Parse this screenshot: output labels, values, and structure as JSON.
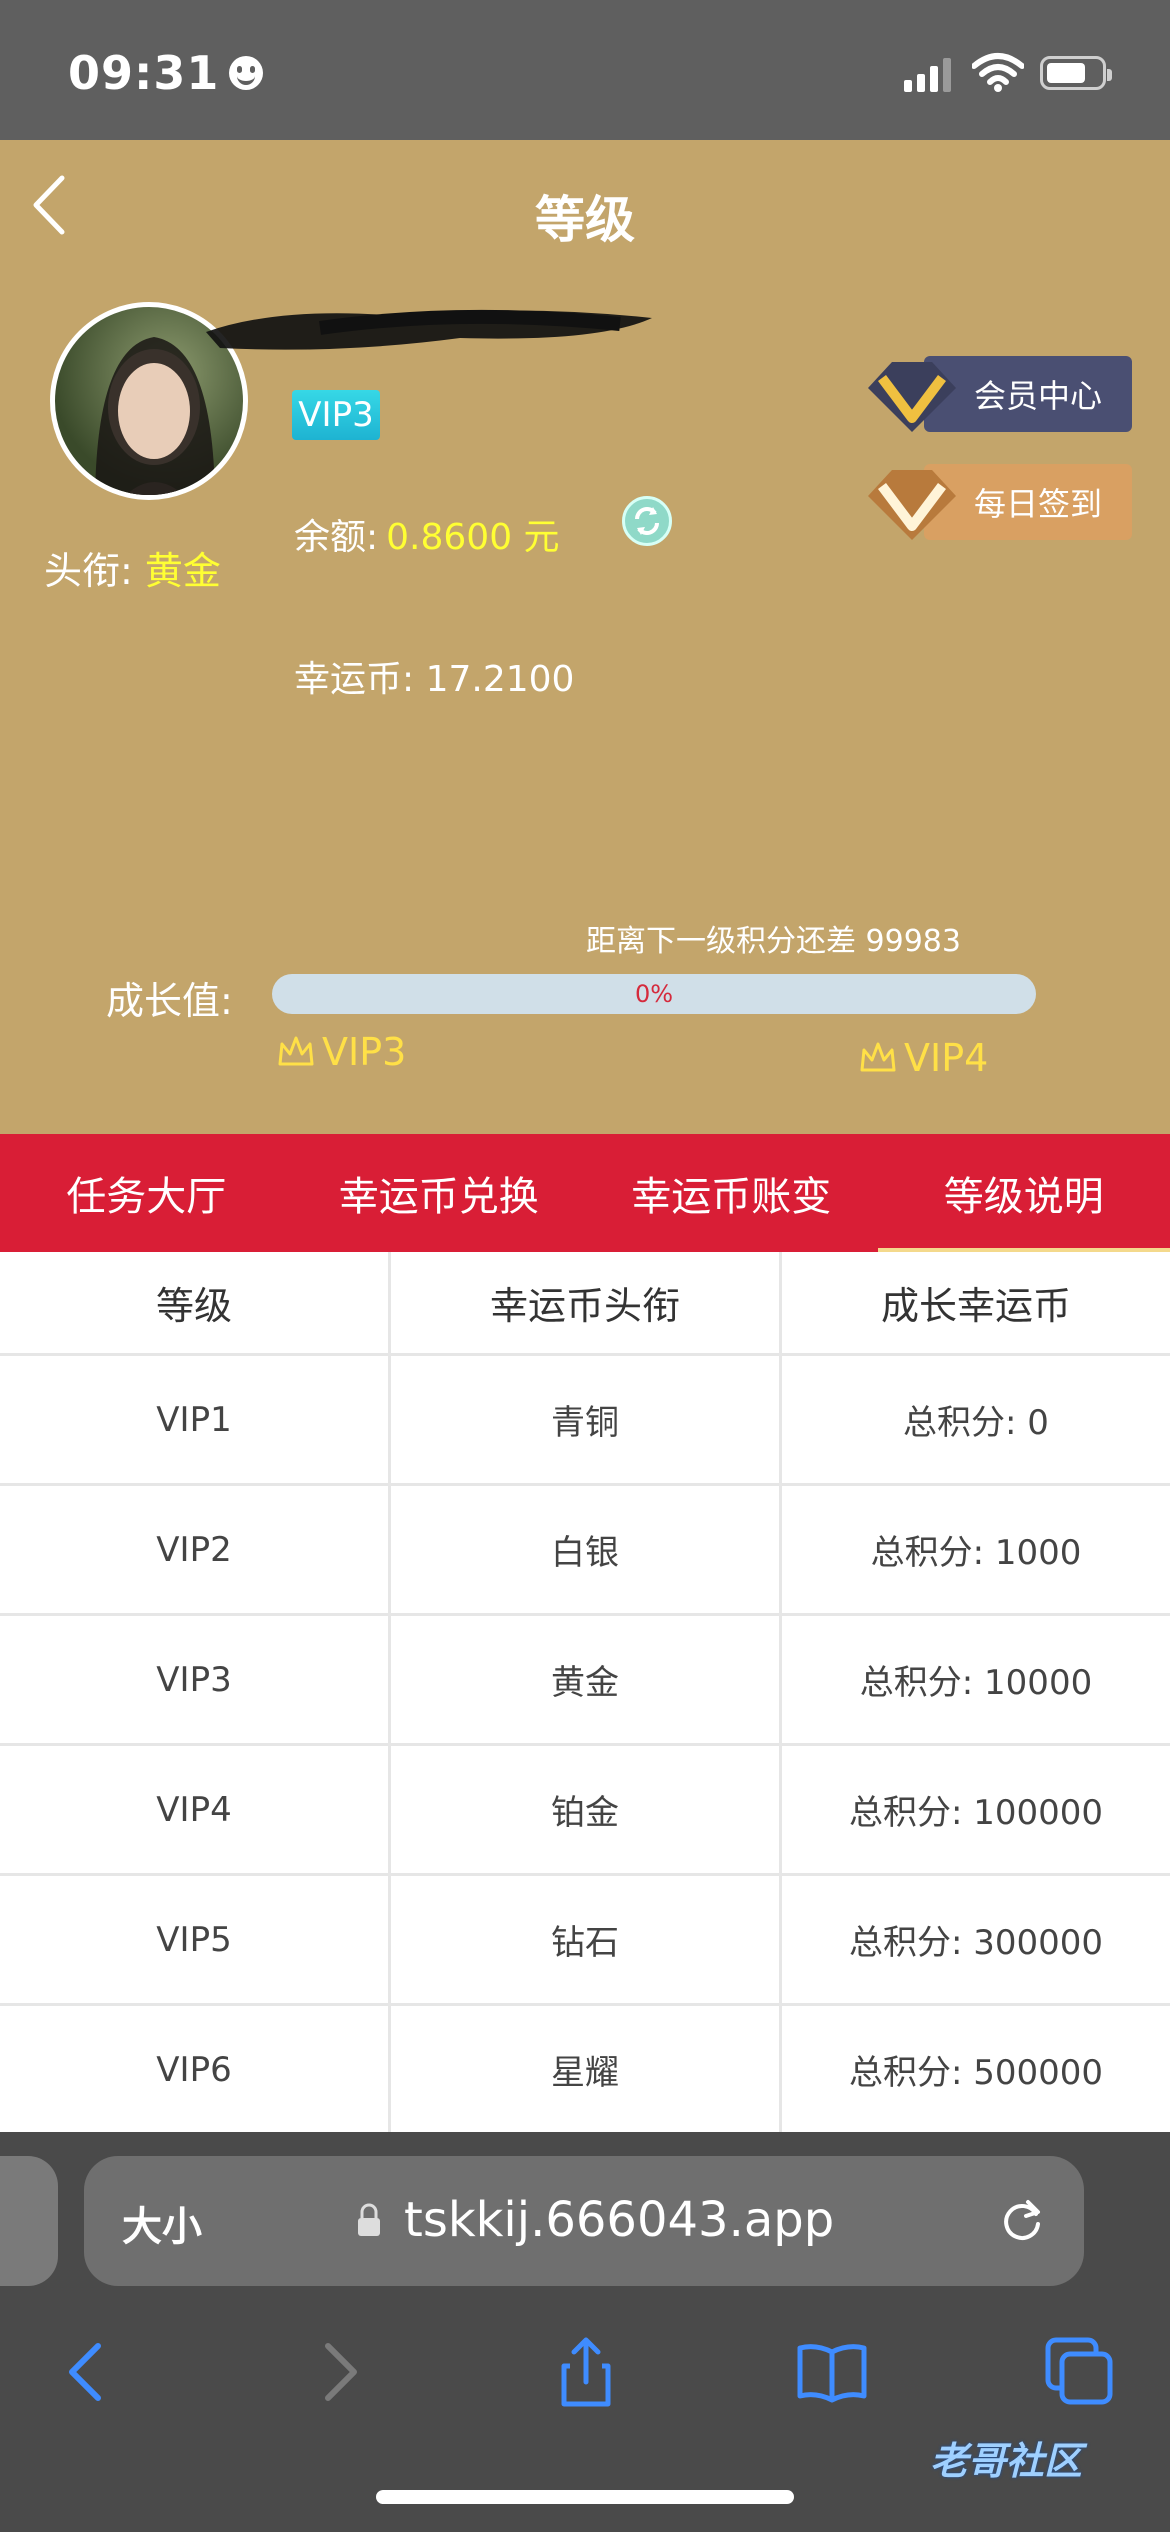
{
  "status_bar": {
    "time": "09:31"
  },
  "header": {
    "title": "等级",
    "vip_badge": "VIP3",
    "rank_label": "头衔:",
    "rank_value": "黄金",
    "balance_label": "余额:",
    "balance_value": "0.8600 元",
    "coins_label": "幸运币:",
    "coins_value": "17.2100",
    "member_center": "会员中心",
    "daily_signin": "每日签到",
    "next_level_text": "距离下一级积分还差 99983",
    "growth_label": "成长值:",
    "progress": 0,
    "progress_text": "0%",
    "current_level": "VIP3",
    "next_level": "VIP4"
  },
  "tabs": [
    {
      "label": "任务大厅"
    },
    {
      "label": "幸运币兑换"
    },
    {
      "label": "幸运币账变"
    },
    {
      "label": "等级说明",
      "active": true
    }
  ],
  "table": {
    "headers": [
      "等级",
      "幸运币头衔",
      "成长幸运币"
    ],
    "rows": [
      [
        "VIP1",
        "青铜",
        "总积分: 0"
      ],
      [
        "VIP2",
        "白银",
        "总积分: 1000"
      ],
      [
        "VIP3",
        "黄金",
        "总积分: 10000"
      ],
      [
        "VIP4",
        "铂金",
        "总积分: 100000"
      ],
      [
        "VIP5",
        "钻石",
        "总积分: 300000"
      ],
      [
        "VIP6",
        "星耀",
        "总积分: 500000"
      ]
    ]
  },
  "browser": {
    "text_size": "大小",
    "url": "tskkij.666043.app"
  },
  "watermark": "老哥社区",
  "colors": {
    "header_bg": "#c3a56b",
    "tab_bg": "#d91e36",
    "gold_text": "#ffff33",
    "member_bg": "#4a4f72",
    "signin_bg": "#d9a062"
  }
}
